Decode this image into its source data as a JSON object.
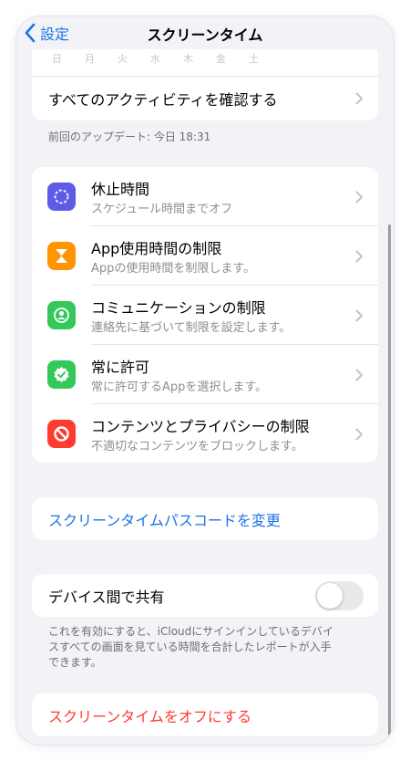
{
  "nav": {
    "back_label": "設定",
    "title": "スクリーンタイム"
  },
  "weekdays": [
    "日",
    "月",
    "火",
    "水",
    "木",
    "金",
    "土"
  ],
  "activity": {
    "see_all_label": "すべてのアクティビティを確認する",
    "last_update": "前回のアップデート: 今日 18:31"
  },
  "settings": [
    {
      "title": "休止時間",
      "subtitle": "スケジュール時間までオフ",
      "icon": "downtime-icon",
      "color": "#5e5ce6"
    },
    {
      "title": "App使用時間の制限",
      "subtitle": "Appの使用時間を制限します。",
      "icon": "hourglass-icon",
      "color": "#ff9500"
    },
    {
      "title": "コミュニケーションの制限",
      "subtitle": "連絡先に基づいて制限を設定します。",
      "icon": "contact-icon",
      "color": "#34c759"
    },
    {
      "title": "常に許可",
      "subtitle": "常に許可するAppを選択します。",
      "icon": "checkmark-badge-icon",
      "color": "#34c759"
    },
    {
      "title": "コンテンツとプライバシーの制限",
      "subtitle": "不適切なコンテンツをブロックします。",
      "icon": "restriction-icon",
      "color": "#ff3b30"
    }
  ],
  "passcode": {
    "label": "スクリーンタイムパスコードを変更",
    "color": "#1a73e8"
  },
  "share": {
    "label": "デバイス間で共有",
    "enabled": false,
    "footer_lines": [
      "これを有効にすると、iCloudにサインインしているデバイ",
      "スすべての画面を見ている時間を合計したレポートが入手",
      "できます。"
    ]
  },
  "turn_off": {
    "label": "スクリーンタイムをオフにする",
    "color": "#ff3b30"
  }
}
